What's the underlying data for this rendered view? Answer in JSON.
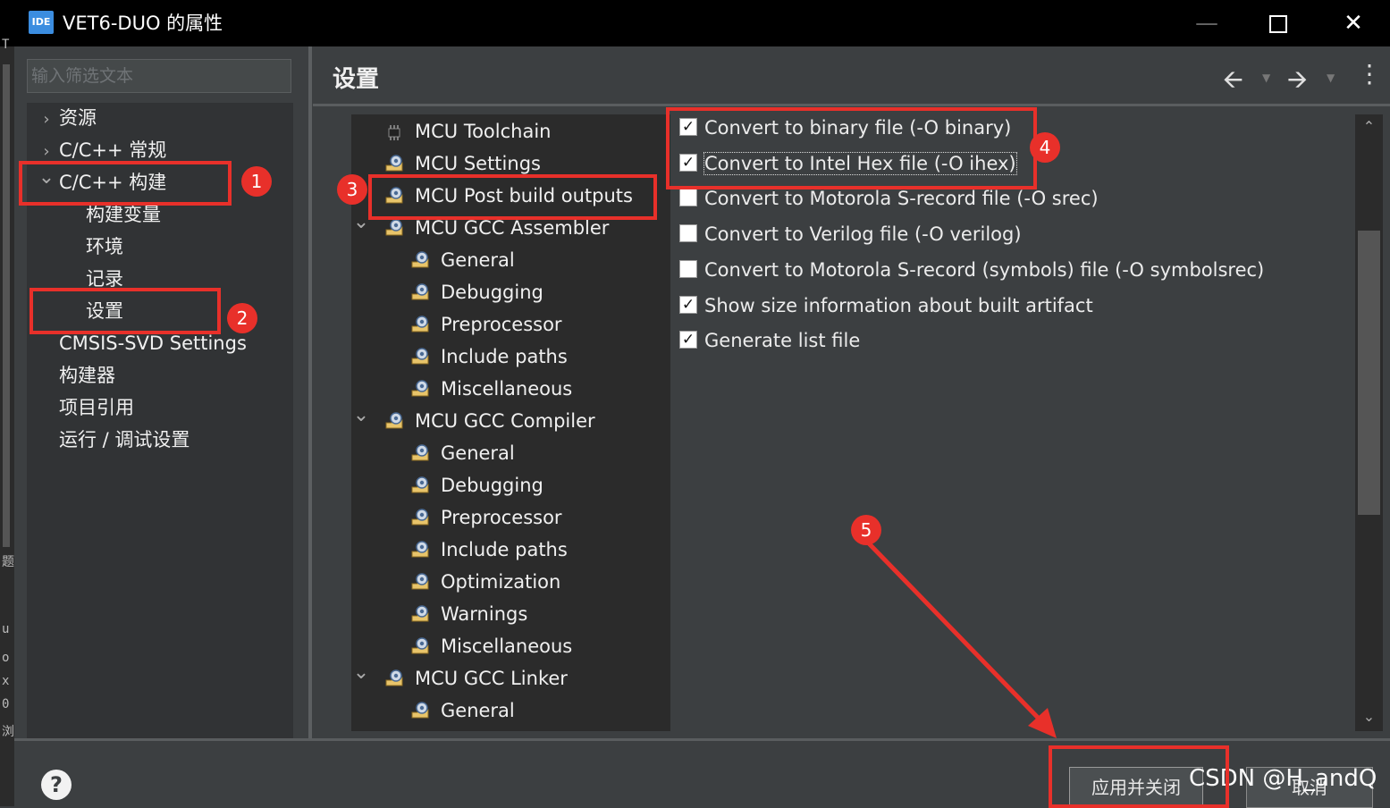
{
  "window": {
    "icon_text": "IDE",
    "title": "VET6-DUO 的属性",
    "controls": [
      "—",
      "",
      "✕"
    ]
  },
  "background_app": {
    "chars": [
      "T",
      "题",
      "u",
      "o",
      "x",
      "0",
      "浏"
    ]
  },
  "filter": {
    "placeholder": "输入筛选文本",
    "value": ""
  },
  "left_tree": [
    {
      "label": "资源",
      "expand": "closed",
      "indent": 0
    },
    {
      "label": "C/C++ 常规",
      "expand": "closed",
      "indent": 0
    },
    {
      "label": "C/C++ 构建",
      "expand": "open",
      "indent": 0
    },
    {
      "label": "构建变量",
      "expand": "none",
      "indent": 1
    },
    {
      "label": "环境",
      "expand": "none",
      "indent": 1
    },
    {
      "label": "记录",
      "expand": "none",
      "indent": 1
    },
    {
      "label": "设置",
      "expand": "none",
      "indent": 1
    },
    {
      "label": "CMSIS-SVD Settings",
      "expand": "none",
      "indent": 0
    },
    {
      "label": "构建器",
      "expand": "none",
      "indent": 0
    },
    {
      "label": "项目引用",
      "expand": "none",
      "indent": 0
    },
    {
      "label": "运行 / 调试设置",
      "expand": "none",
      "indent": 0
    }
  ],
  "page": {
    "title": "设置",
    "nav_icons": [
      "back-arrow-icon",
      "forward-arrow-icon",
      "more-vertical-icon"
    ]
  },
  "mid_tree": [
    {
      "label": "MCU Toolchain",
      "level": 0,
      "icon": "chip-icon",
      "expand": "none"
    },
    {
      "label": "MCU Settings",
      "level": 0,
      "icon": "settings-gear-icon",
      "expand": "none"
    },
    {
      "label": "MCU Post build outputs",
      "level": 0,
      "icon": "settings-gear-icon",
      "expand": "none"
    },
    {
      "label": "MCU GCC Assembler",
      "level": 0,
      "icon": "settings-gear-icon",
      "expand": "open"
    },
    {
      "label": "General",
      "level": 1,
      "icon": "settings-gear-icon",
      "expand": "none"
    },
    {
      "label": "Debugging",
      "level": 1,
      "icon": "settings-gear-icon",
      "expand": "none"
    },
    {
      "label": "Preprocessor",
      "level": 1,
      "icon": "settings-gear-icon",
      "expand": "none"
    },
    {
      "label": "Include paths",
      "level": 1,
      "icon": "settings-gear-icon",
      "expand": "none"
    },
    {
      "label": "Miscellaneous",
      "level": 1,
      "icon": "settings-gear-icon",
      "expand": "none"
    },
    {
      "label": "MCU GCC Compiler",
      "level": 0,
      "icon": "settings-gear-icon",
      "expand": "open"
    },
    {
      "label": "General",
      "level": 1,
      "icon": "settings-gear-icon",
      "expand": "none"
    },
    {
      "label": "Debugging",
      "level": 1,
      "icon": "settings-gear-icon",
      "expand": "none"
    },
    {
      "label": "Preprocessor",
      "level": 1,
      "icon": "settings-gear-icon",
      "expand": "none"
    },
    {
      "label": "Include paths",
      "level": 1,
      "icon": "settings-gear-icon",
      "expand": "none"
    },
    {
      "label": "Optimization",
      "level": 1,
      "icon": "settings-gear-icon",
      "expand": "none"
    },
    {
      "label": "Warnings",
      "level": 1,
      "icon": "settings-gear-icon",
      "expand": "none"
    },
    {
      "label": "Miscellaneous",
      "level": 1,
      "icon": "settings-gear-icon",
      "expand": "none"
    },
    {
      "label": "MCU GCC Linker",
      "level": 0,
      "icon": "settings-gear-icon",
      "expand": "open"
    },
    {
      "label": "General",
      "level": 1,
      "icon": "settings-gear-icon",
      "expand": "none"
    }
  ],
  "options": [
    {
      "label": "Convert to binary file (-O binary)",
      "checked": true
    },
    {
      "label": "Convert to Intel Hex file (-O ihex)",
      "checked": true
    },
    {
      "label": "Convert to Motorola S-record file (-O srec)",
      "checked": false
    },
    {
      "label": "Convert to Verilog file (-O verilog)",
      "checked": false
    },
    {
      "label": "Convert to Motorola S-record (symbols) file (-O symbolsrec)",
      "checked": false
    },
    {
      "label": "Show size information about built artifact",
      "checked": true
    },
    {
      "label": "Generate list file",
      "checked": true
    }
  ],
  "footer": {
    "help": "?",
    "apply_close": "应用并关闭",
    "cancel": "取消"
  },
  "watermark": "CSDN @H_andQ",
  "annotations": [
    "1",
    "2",
    "3",
    "4",
    "5"
  ],
  "colors": {
    "annotation_red": "#e8302a",
    "bg": "#3c3f41",
    "tree_bg": "#2b2b2b"
  }
}
